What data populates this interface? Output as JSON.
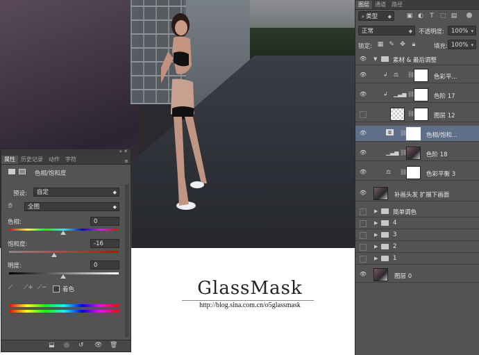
{
  "watermark": {
    "title": "GlassMask",
    "url": "http://blog.sina.com.cn/o5glassmask"
  },
  "layers_panel": {
    "tabs": [
      "图层",
      "通道",
      "路径"
    ],
    "filter_kind": "类型",
    "blend_mode": "正常",
    "opacity_label": "不透明度:",
    "opacity_value": "100%",
    "lock_label": "锁定:",
    "fill_label": "填充:",
    "fill_value": "100%",
    "layers": [
      {
        "name": "素材 & 最后调整",
        "type": "group-open",
        "visible": true
      },
      {
        "name": "色彩平...",
        "type": "adjustment",
        "icon": "balance-icon",
        "visible": true
      },
      {
        "name": "色阶 17",
        "type": "adjustment",
        "icon": "levels-icon",
        "visible": true
      },
      {
        "name": "图层 12",
        "type": "pixel",
        "visible": false
      },
      {
        "name": "色相/饱和...",
        "type": "adjustment",
        "icon": "hue-sat-icon",
        "visible": true,
        "selected": true
      },
      {
        "name": "色阶 18",
        "type": "adjustment",
        "icon": "levels-icon",
        "visible": true
      },
      {
        "name": "色彩平衡 3",
        "type": "adjustment",
        "icon": "balance-icon",
        "visible": true
      },
      {
        "name": "补画头发  扩展下画面",
        "type": "photo",
        "visible": true
      },
      {
        "name": "简单调色",
        "type": "group",
        "visible": false
      },
      {
        "name": "4",
        "type": "group",
        "visible": false
      },
      {
        "name": "3",
        "type": "group",
        "visible": false
      },
      {
        "name": "2",
        "type": "group",
        "visible": false
      },
      {
        "name": "1",
        "type": "group",
        "visible": false
      },
      {
        "name": "图层 0",
        "type": "photo",
        "visible": true
      }
    ]
  },
  "properties_panel": {
    "tabs": [
      "属性",
      "历史记录",
      "动作",
      "字符"
    ],
    "title": "色相/饱和度",
    "preset_label": "预设:",
    "preset_value": "自定",
    "channel_value": "全图",
    "hue_label": "色相:",
    "hue_value": "0",
    "saturation_label": "饱和度:",
    "saturation_value": "-16",
    "lightness_label": "明度:",
    "lightness_value": "0",
    "colorize_label": "着色"
  }
}
